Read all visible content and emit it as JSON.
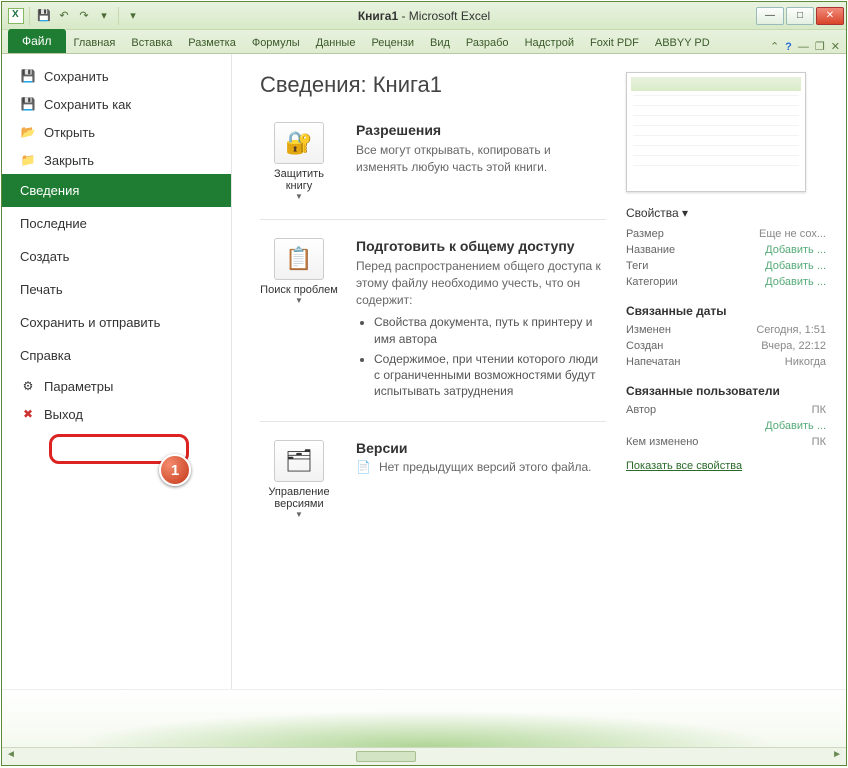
{
  "title": {
    "doc": "Книга1",
    "app": "Microsoft Excel"
  },
  "tabs": {
    "file": "Файл",
    "list": [
      "Главная",
      "Вставка",
      "Разметка",
      "Формулы",
      "Данные",
      "Рецензи",
      "Вид",
      "Разрабо",
      "Надстрой",
      "Foxit PDF",
      "ABBYY PD"
    ]
  },
  "nav": {
    "save": "Сохранить",
    "saveas": "Сохранить как",
    "open": "Открыть",
    "close": "Закрыть",
    "info": "Сведения",
    "recent": "Последние",
    "new": "Создать",
    "print": "Печать",
    "share": "Сохранить и отправить",
    "help": "Справка",
    "options": "Параметры",
    "exit": "Выход"
  },
  "annotation": {
    "num": "1"
  },
  "main": {
    "heading": "Сведения: Книга1",
    "perm": {
      "btn": "Защитить книгу",
      "title": "Разрешения",
      "text": "Все могут открывать, копировать и изменять любую часть этой книги."
    },
    "prep": {
      "btn": "Поиск проблем",
      "title": "Подготовить к общему доступу",
      "text": "Перед распространением общего доступа к этому файлу необходимо учесть, что он содержит:",
      "li1": "Свойства документа, путь к принтеру и имя автора",
      "li2": "Содержимое, при чтении которого люди с ограниченными возможностями будут испытывать затруднения"
    },
    "ver": {
      "btn": "Управление версиями",
      "title": "Версии",
      "text": "Нет предыдущих версий этого файла."
    }
  },
  "props": {
    "header": "Свойства",
    "size_k": "Размер",
    "size_v": "Еще не сох...",
    "title_k": "Название",
    "title_v": "Добавить ...",
    "tags_k": "Теги",
    "tags_v": "Добавить ...",
    "cat_k": "Категории",
    "cat_v": "Добавить ...",
    "dates_h": "Связанные даты",
    "mod_k": "Изменен",
    "mod_v": "Сегодня, 1:51",
    "cre_k": "Создан",
    "cre_v": "Вчера, 22:12",
    "prn_k": "Напечатан",
    "prn_v": "Никогда",
    "users_h": "Связанные пользователи",
    "auth_k": "Автор",
    "auth_v": "ПК",
    "auth_add": "Добавить ...",
    "modby_k": "Кем изменено",
    "modby_v": "ПК",
    "show_all": "Показать все свойства"
  }
}
